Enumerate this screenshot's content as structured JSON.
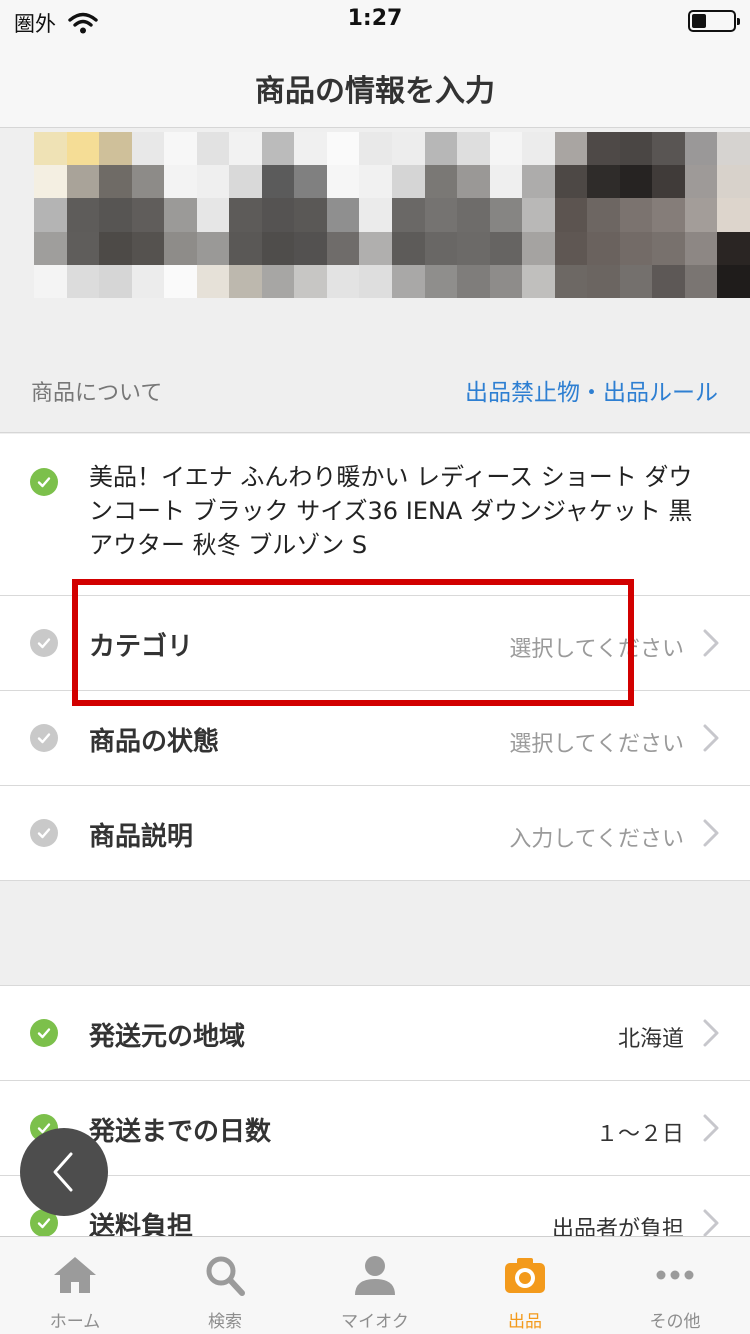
{
  "status_bar": {
    "carrier": "圏外",
    "time": "1:27",
    "battery_level": 0.35
  },
  "nav": {
    "title": "商品の情報を入力"
  },
  "section": {
    "label": "商品について",
    "rules_link": "出品禁止物・出品ルール"
  },
  "item": {
    "title": "美品！イエナ ふんわり暖かい レディース ショート ダウンコート ブラック サイズ36 IENA ダウンジャケット 黒 アウター 秋冬 ブルゾン S"
  },
  "rows_top": [
    {
      "label": "カテゴリ",
      "value": "選択してください",
      "status": "todo"
    },
    {
      "label": "商品の状態",
      "value": "選択してください",
      "status": "todo"
    },
    {
      "label": "商品説明",
      "value": "入力してください",
      "status": "todo"
    }
  ],
  "rows_shipping": [
    {
      "label": "発送元の地域",
      "value": "北海道",
      "status": "done"
    },
    {
      "label": "発送までの日数",
      "value": "１〜２日",
      "status": "done"
    },
    {
      "label": "送料負担",
      "value": "出品者が負担",
      "status": "done"
    }
  ],
  "tabs": [
    {
      "label": "ホーム",
      "icon": "home-icon"
    },
    {
      "label": "検索",
      "icon": "search-icon"
    },
    {
      "label": "マイオク",
      "icon": "person-icon"
    },
    {
      "label": "出品",
      "icon": "camera-icon",
      "active": true
    },
    {
      "label": "その他",
      "icon": "more-icon"
    }
  ],
  "colors": {
    "accent_blue": "#2e7fd2",
    "check_green": "#7cc04b",
    "active_tab": "#f39a1c",
    "highlight_red": "#d20000"
  }
}
